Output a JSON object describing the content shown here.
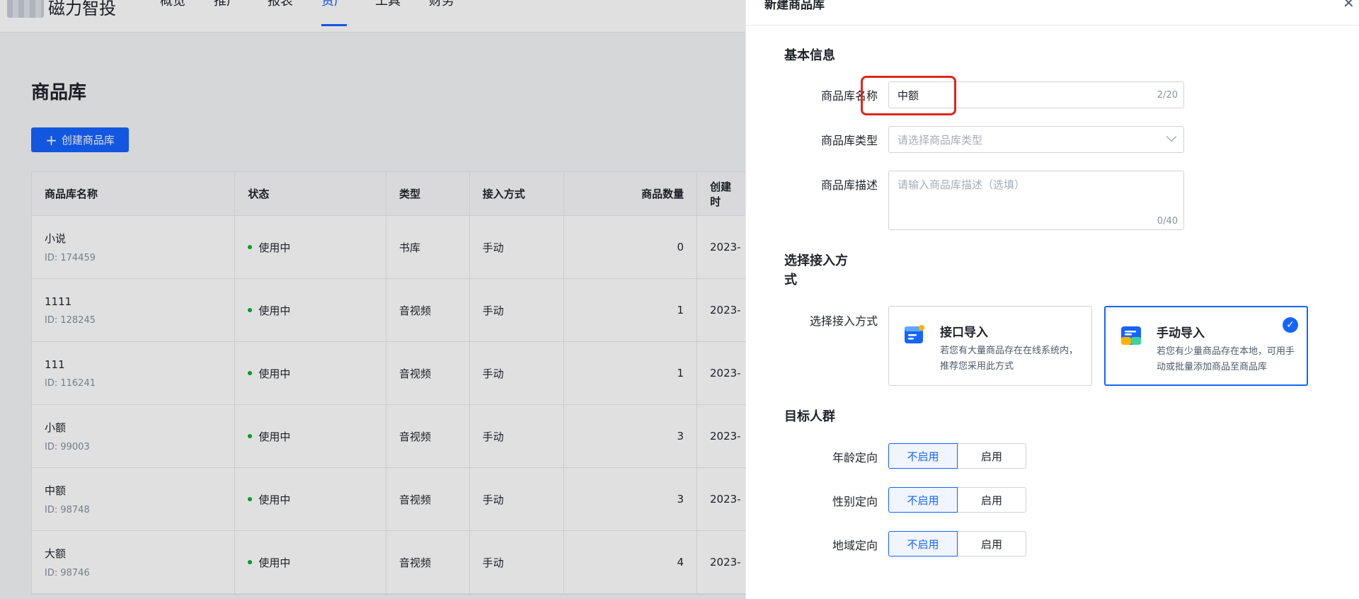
{
  "app": {
    "logo_text": "磁力智投"
  },
  "nav": {
    "items": [
      "概览",
      "推广",
      "报表",
      "资产",
      "工具",
      "财务"
    ],
    "active": "资产"
  },
  "page": {
    "title": "商品库",
    "create_button": "创建商品库"
  },
  "table": {
    "headers": [
      "商品库名称",
      "状态",
      "类型",
      "接入方式",
      "商品数量",
      "创建时"
    ],
    "rows": [
      {
        "name": "小说",
        "id": "ID: 174459",
        "status": "使用中",
        "type": "书库",
        "access": "手动",
        "count": "0",
        "created": "2023-"
      },
      {
        "name": "1111",
        "id": "ID: 128245",
        "status": "使用中",
        "type": "音视频",
        "access": "手动",
        "count": "1",
        "created": "2023-"
      },
      {
        "name": "111",
        "id": "ID: 116241",
        "status": "使用中",
        "type": "音视频",
        "access": "手动",
        "count": "1",
        "created": "2023-"
      },
      {
        "name": "小额",
        "id": "ID: 99003",
        "status": "使用中",
        "type": "音视频",
        "access": "手动",
        "count": "3",
        "created": "2023-"
      },
      {
        "name": "中额",
        "id": "ID: 98748",
        "status": "使用中",
        "type": "音视频",
        "access": "手动",
        "count": "3",
        "created": "2023-"
      },
      {
        "name": "大额",
        "id": "ID: 98746",
        "status": "使用中",
        "type": "音视频",
        "access": "手动",
        "count": "4",
        "created": "2023-"
      }
    ]
  },
  "drawer": {
    "title": "新建商品库",
    "section_basic": "基本信息",
    "name_label": "商品库名称",
    "name_value": "中额",
    "name_count": "2/20",
    "type_label": "商品库类型",
    "type_placeholder": "请选择商品库类型",
    "desc_label": "商品库描述",
    "desc_placeholder": "请输入商品库描述（选填）",
    "desc_count": "0/40",
    "section_access_line1": "选择接入方",
    "section_access_line2": "式",
    "access_label": "选择接入方式",
    "access_api_title": "接口导入",
    "access_api_desc": "若您有大量商品存在在线系统内，推荐您采用此方式",
    "access_manual_title": "手动导入",
    "access_manual_desc": "若您有少量商品存在本地，可用手动或批量添加商品至商品库",
    "section_target": "目标人群",
    "age_label": "年龄定向",
    "gender_label": "性别定向",
    "region_label": "地域定向",
    "off_label": "不启用",
    "on_label": "启用"
  },
  "colors": {
    "primary": "#1664ff",
    "status_green": "#00b42a",
    "highlight_red": "#e0261c"
  }
}
